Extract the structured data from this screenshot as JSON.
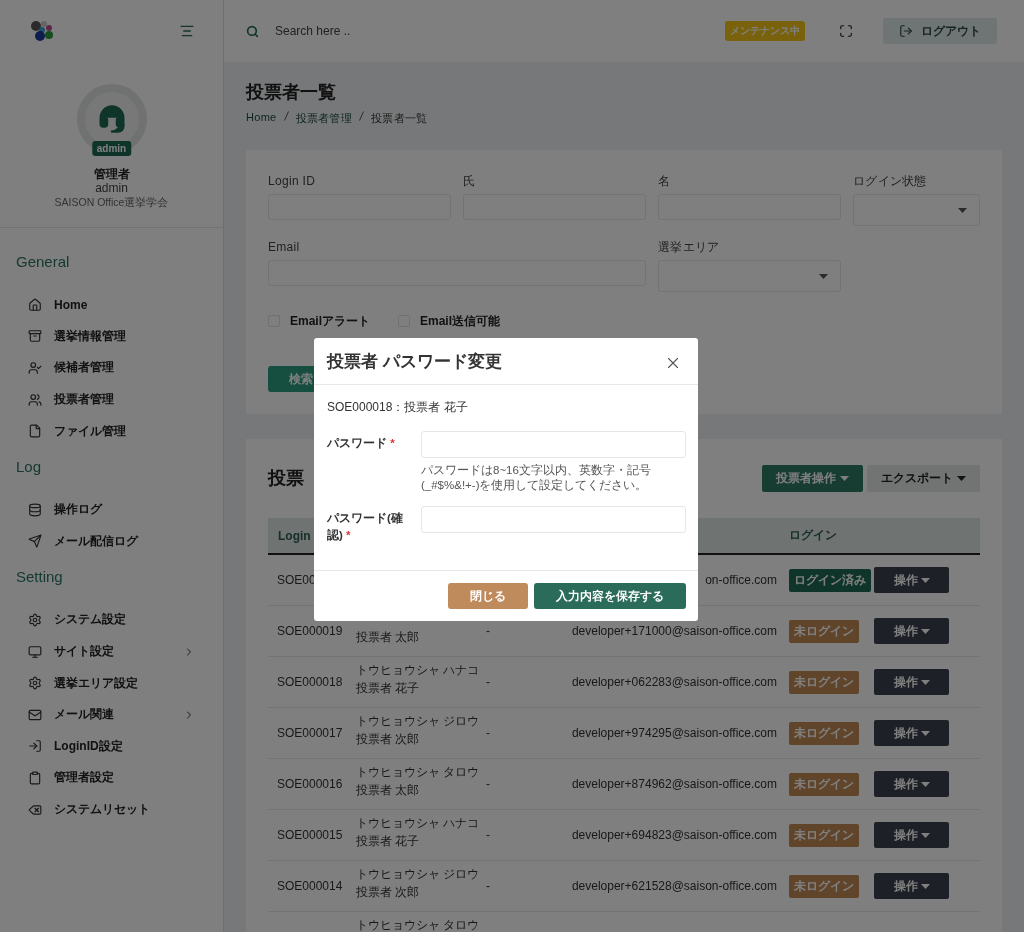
{
  "sidebar": {
    "user_name": "管理者",
    "role_badge": "admin",
    "user_id": "admin",
    "organization": "SAISON Office選挙学会",
    "sections": [
      {
        "title": "General",
        "items": [
          {
            "label": "Home",
            "has_submenu": false
          },
          {
            "label": "選挙情報管理",
            "has_submenu": false
          },
          {
            "label": "候補者管理",
            "has_submenu": false
          },
          {
            "label": "投票者管理",
            "has_submenu": false
          },
          {
            "label": "ファイル管理",
            "has_submenu": false
          }
        ]
      },
      {
        "title": "Log",
        "items": [
          {
            "label": "操作ログ",
            "has_submenu": false
          },
          {
            "label": "メール配信ログ",
            "has_submenu": false
          }
        ]
      },
      {
        "title": "Setting",
        "items": [
          {
            "label": "システム設定",
            "has_submenu": false
          },
          {
            "label": "サイト設定",
            "has_submenu": true
          },
          {
            "label": "選挙エリア設定",
            "has_submenu": false
          },
          {
            "label": "メール関連",
            "has_submenu": true
          },
          {
            "label": "LoginID設定",
            "has_submenu": false
          },
          {
            "label": "管理者設定",
            "has_submenu": false
          },
          {
            "label": "システムリセット",
            "has_submenu": false
          }
        ]
      }
    ]
  },
  "topbar": {
    "search_placeholder": "Search here ..",
    "maintenance_badge": "メンテナンス中",
    "logout": "ログアウト"
  },
  "page": {
    "title": "投票者一覧",
    "breadcrumb": [
      "Home",
      "投票者管理",
      "投票者一覧"
    ]
  },
  "filters": {
    "fields": [
      {
        "label": "Login ID",
        "kind": "text"
      },
      {
        "label": "氏",
        "kind": "text"
      },
      {
        "label": "名",
        "kind": "text"
      },
      {
        "label": "ログイン状態",
        "kind": "select"
      },
      {
        "label": "Email",
        "kind": "wide"
      },
      {
        "label": "選挙エリア",
        "kind": "select"
      }
    ],
    "checkboxes": [
      {
        "label": "Emailアラート",
        "checked": false
      },
      {
        "label": "Email送信可能",
        "checked": false
      }
    ],
    "search_button": "検索"
  },
  "table": {
    "title": "投票",
    "buttons": [
      {
        "label": "投票者操作",
        "kind": "primary"
      },
      {
        "label": "エクスポート",
        "kind": "secondary"
      }
    ],
    "columns": [
      "Login",
      "ログイン"
    ],
    "rows": [
      {
        "login_id": "SOE00",
        "email": "on-office.com",
        "status": {
          "label": "ログイン済み",
          "kind": "logged_in"
        },
        "action": "操作"
      },
      {
        "login_id": "SOE000019",
        "name": "投票者 太郎",
        "dash": "-",
        "email": "developer+171000@saison-office.com",
        "status": {
          "label": "未ログイン",
          "kind": "not_logged_in"
        },
        "action": "操作"
      },
      {
        "login_id": "SOE000018",
        "kana": "トウヒョウシャ ハナコ",
        "name": "投票者 花子",
        "dash": "-",
        "email": "developer+062283@saison-office.com",
        "status": {
          "label": "未ログイン",
          "kind": "not_logged_in"
        },
        "action": "操作"
      },
      {
        "login_id": "SOE000017",
        "kana": "トウヒョウシャ ジロウ",
        "name": "投票者 次郎",
        "dash": "-",
        "email": "developer+974295@saison-office.com",
        "status": {
          "label": "未ログイン",
          "kind": "not_logged_in"
        },
        "action": "操作"
      },
      {
        "login_id": "SOE000016",
        "kana": "トウヒョウシャ タロウ",
        "name": "投票者 太郎",
        "dash": "-",
        "email": "developer+874962@saison-office.com",
        "status": {
          "label": "未ログイン",
          "kind": "not_logged_in"
        },
        "action": "操作"
      },
      {
        "login_id": "SOE000015",
        "kana": "トウヒョウシャ ハナコ",
        "name": "投票者 花子",
        "dash": "-",
        "email": "developer+694823@saison-office.com",
        "status": {
          "label": "未ログイン",
          "kind": "not_logged_in"
        },
        "action": "操作"
      },
      {
        "login_id": "SOE000014",
        "kana": "トウヒョウシャ ジロウ",
        "name": "投票者 次郎",
        "dash": "-",
        "email": "developer+621528@saison-office.com",
        "status": {
          "label": "未ログイン",
          "kind": "not_logged_in"
        },
        "action": "操作"
      },
      {
        "kana": "トウヒョウシャ タロウ"
      }
    ]
  },
  "dialog": {
    "title": "投票者 パスワード変更",
    "subject": "SOE000018：投票者 花子",
    "fields": [
      {
        "label": "パスワード",
        "required_mark": "*",
        "hint": "パスワードは8~16文字以内、英数字・記号(_#$%&!+-)を使用して設定してください。"
      },
      {
        "label": "パスワード(確認)",
        "required_mark": "*"
      }
    ],
    "buttons": [
      {
        "label": "閉じる",
        "kind": "cancel"
      },
      {
        "label": "入力内容を保存する",
        "kind": "save"
      }
    ]
  }
}
